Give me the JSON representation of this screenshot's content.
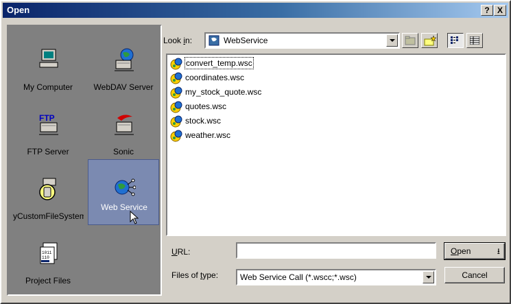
{
  "window": {
    "title": "Open",
    "help_label": "?",
    "close_label": "X"
  },
  "places": [
    {
      "label": "My Computer",
      "icon": "computer-icon"
    },
    {
      "label": "WebDAV Server",
      "icon": "globe-server-icon"
    },
    {
      "label": "FTP Server",
      "icon": "ftp-server-icon"
    },
    {
      "label": "Sonic",
      "icon": "sonic-server-icon"
    },
    {
      "label": "MyCustomFileSystem",
      "icon": "custom-filesystem-icon"
    },
    {
      "label": "Web Service",
      "icon": "web-service-icon",
      "selected": true
    },
    {
      "label": "Project Files",
      "icon": "project-files-icon"
    }
  ],
  "look_in": {
    "label_pre": "Look ",
    "label_accel": "i",
    "label_post": "n:",
    "value": "WebService"
  },
  "files": [
    {
      "name": "convert_temp.wsc",
      "focused": true
    },
    {
      "name": "coordinates.wsc"
    },
    {
      "name": "my_stock_quote.wsc"
    },
    {
      "name": "quotes.wsc"
    },
    {
      "name": "stock.wsc"
    },
    {
      "name": "weather.wsc"
    }
  ],
  "url": {
    "label_accel": "U",
    "label_post": "RL:",
    "value": ""
  },
  "files_of_type": {
    "label_pre": "Files of ",
    "label_accel": "t",
    "label_post": "ype:",
    "value": "Web Service Call (*.wscc;*.wsc)"
  },
  "buttons": {
    "open_accel": "O",
    "open_post": "pen",
    "open_arrow": "⭳",
    "cancel": "Cancel"
  },
  "colors": {
    "title_start": "#0a246a",
    "selected_place": "#7b8ab1",
    "face": "#d4d0c8"
  }
}
